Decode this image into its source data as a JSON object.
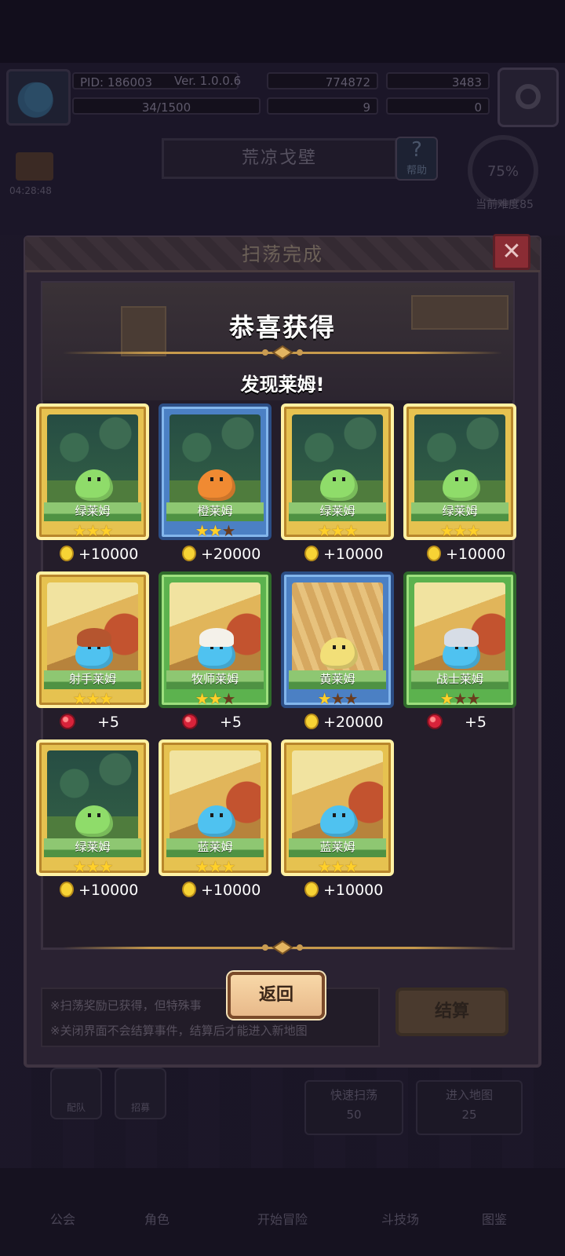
{
  "bg": {
    "pid": "PID: 186003",
    "version": "Ver. 1.0.0.6",
    "gold": "774872",
    "gems": "3483",
    "exp": "34/1500",
    "clover": "9",
    "keys": "0",
    "map_title": "荒凉戈壁",
    "help": "帮助",
    "difficulty_pct": "75%",
    "difficulty_label": "当前难度85",
    "timer": "04:28:48",
    "btn_team": "配队",
    "btn_recruit": "招募",
    "quick_sweep": "快速扫荡",
    "quick_sweep_cost": "50",
    "enter_map": "进入地图",
    "enter_map_cost": "25",
    "nav": [
      "公会",
      "角色",
      "开始冒险",
      "斗技场",
      "图鉴"
    ]
  },
  "dialog": {
    "title": "扫荡完成",
    "congrats": "恭喜获得",
    "found": "发现莱姆!",
    "back": "返回",
    "settle": "结算",
    "notice1": "※扫荡奖励已获得，但特殊事",
    "notice2": "※关闭界面不会结算事件，结算后才能进入新地图"
  },
  "cards": [
    {
      "name": "绿莱姆",
      "stars": 3,
      "rarity": "gold",
      "art": "forest",
      "slime": "#8fdc6a",
      "hat": "",
      "reward_type": "coin",
      "reward": "+10000"
    },
    {
      "name": "橙莱姆",
      "stars": 2,
      "rarity": "blue",
      "art": "forest",
      "slime": "#f08a32",
      "hat": "",
      "reward_type": "coin",
      "reward": "+20000"
    },
    {
      "name": "绿莱姆",
      "stars": 3,
      "rarity": "gold",
      "art": "forest",
      "slime": "#8fdc6a",
      "hat": "",
      "reward_type": "coin",
      "reward": "+10000"
    },
    {
      "name": "绿莱姆",
      "stars": 3,
      "rarity": "gold",
      "art": "forest",
      "slime": "#8fdc6a",
      "hat": "",
      "reward_type": "coin",
      "reward": "+10000"
    },
    {
      "name": "射手莱姆",
      "stars": 3,
      "rarity": "gold",
      "art": "desert",
      "slime": "#4fc2f0",
      "hat": "archer",
      "reward_type": "ruby",
      "reward": "+5"
    },
    {
      "name": "牧师莱姆",
      "stars": 2,
      "rarity": "green",
      "art": "desert",
      "slime": "#4fc2f0",
      "hat": "priest",
      "reward_type": "ruby",
      "reward": "+5"
    },
    {
      "name": "黄莱姆",
      "stars": 1,
      "rarity": "blue",
      "art": "wheat",
      "slime": "#f2df78",
      "hat": "",
      "reward_type": "coin",
      "reward": "+20000"
    },
    {
      "name": "战士莱姆",
      "stars": 1,
      "rarity": "green",
      "art": "desert",
      "slime": "#4fc2f0",
      "hat": "warrior",
      "reward_type": "ruby",
      "reward": "+5"
    },
    {
      "name": "绿莱姆",
      "stars": 3,
      "rarity": "gold",
      "art": "forest",
      "slime": "#8fdc6a",
      "hat": "",
      "reward_type": "coin",
      "reward": "+10000"
    },
    {
      "name": "蓝莱姆",
      "stars": 3,
      "rarity": "gold",
      "art": "desert",
      "slime": "#4fc2f0",
      "hat": "",
      "reward_type": "coin",
      "reward": "+10000"
    },
    {
      "name": "蓝莱姆",
      "stars": 3,
      "rarity": "gold",
      "art": "desert",
      "slime": "#4fc2f0",
      "hat": "",
      "reward_type": "coin",
      "reward": "+10000"
    }
  ]
}
